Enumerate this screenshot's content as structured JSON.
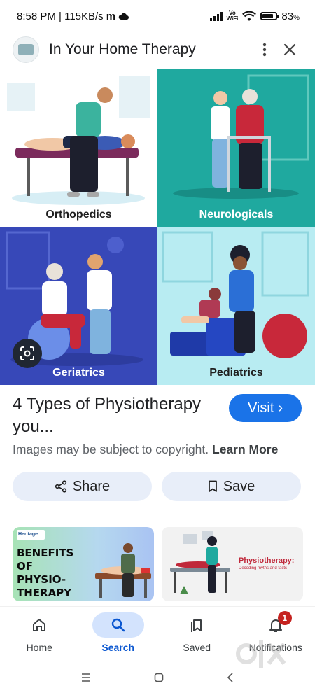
{
  "status_bar": {
    "time_speed": "8:58 PM | 115KB/s",
    "carrier_letter": "m",
    "vowifi_top": "Vo",
    "vowifi_bottom": "WiFi",
    "battery_pct": "83",
    "battery_unit": "%",
    "battery_level": 0.83
  },
  "header": {
    "title": "In Your Home Therapy",
    "menu_icon": "more-vert-icon",
    "close_icon": "close-icon"
  },
  "tiles": [
    {
      "label": "Orthopedics",
      "bg": "#ffffff",
      "label_color": "#1f1f1f"
    },
    {
      "label": "Neurologicals",
      "bg": "#1fa99f",
      "label_color": "#ffffff"
    },
    {
      "label": "Geriatrics",
      "bg": "#3748b8",
      "label_color": "#ffffff"
    },
    {
      "label": "Pediatrics",
      "bg": "#b8ecf2",
      "label_color": "#1f1f1f"
    }
  ],
  "result": {
    "title": "4 Types of Physiotherapy you...",
    "visit_label": "Visit",
    "visit_chevron": "›",
    "copyright_text": "Images may be subject to copyright.",
    "learn_more": "Learn More",
    "share_label": "Share",
    "save_label": "Save"
  },
  "related": [
    {
      "badge": "Heritage",
      "text_lines": [
        "BENEFITS",
        "OF",
        "PHYSIO-",
        "THERAPY"
      ]
    },
    {
      "title": "Physiotherapy:",
      "subtitle": "Decoding myths and facts"
    }
  ],
  "bottom_nav": [
    {
      "label": "Home",
      "icon": "home-icon",
      "active": false
    },
    {
      "label": "Search",
      "icon": "search-icon",
      "active": true
    },
    {
      "label": "Saved",
      "icon": "bookmarks-icon",
      "active": false
    },
    {
      "label": "Notifications",
      "icon": "bell-icon",
      "active": false,
      "badge": "1"
    }
  ],
  "watermark": "OLX",
  "colors": {
    "accent": "#1a73e8",
    "pill_bg": "#e8eef9",
    "nav_active_bg": "#d3e3fd",
    "badge": "#c5221f"
  }
}
